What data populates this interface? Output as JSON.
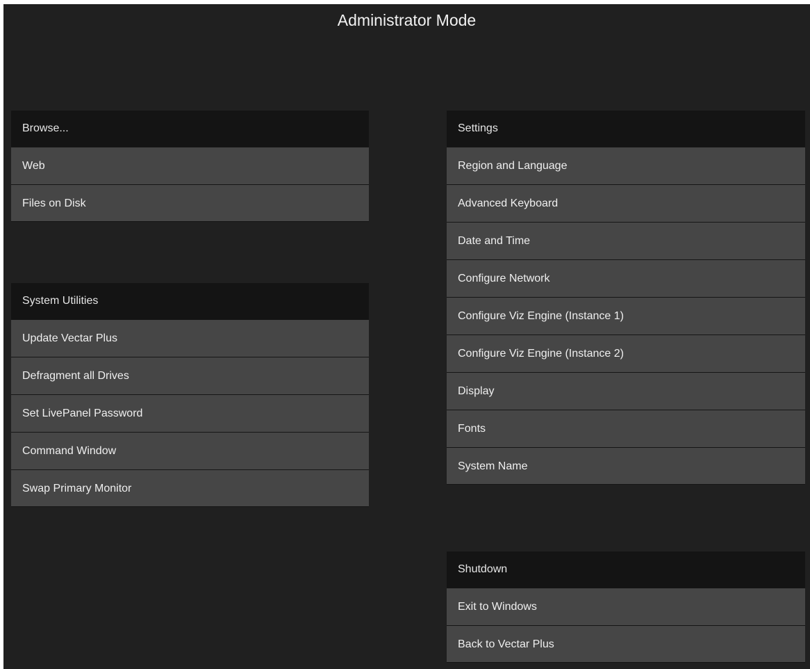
{
  "window": {
    "title": "Administrator Mode"
  },
  "browse": {
    "header": "Browse...",
    "items": [
      {
        "label": "Web"
      },
      {
        "label": "Files on Disk"
      }
    ]
  },
  "system_utilities": {
    "header": "System Utilities",
    "items": [
      {
        "label": "Update Vectar Plus"
      },
      {
        "label": "Defragment all Drives"
      },
      {
        "label": "Set LivePanel Password"
      },
      {
        "label": "Command Window"
      },
      {
        "label": "Swap Primary Monitor"
      }
    ]
  },
  "settings": {
    "header": "Settings",
    "items": [
      {
        "label": "Region and Language"
      },
      {
        "label": "Advanced Keyboard"
      },
      {
        "label": "Date and Time"
      },
      {
        "label": "Configure Network"
      },
      {
        "label": "Configure Viz Engine (Instance 1)"
      },
      {
        "label": "Configure Viz Engine (Instance 2)"
      },
      {
        "label": "Display"
      },
      {
        "label": "Fonts"
      },
      {
        "label": "System Name"
      }
    ]
  },
  "shutdown": {
    "header": "Shutdown",
    "items": [
      {
        "label": "Exit to Windows"
      },
      {
        "label": "Back to Vectar Plus"
      }
    ]
  },
  "colors": {
    "background": "#202020",
    "header_background": "#141414",
    "item_background": "#464646",
    "text": "#efefef"
  }
}
